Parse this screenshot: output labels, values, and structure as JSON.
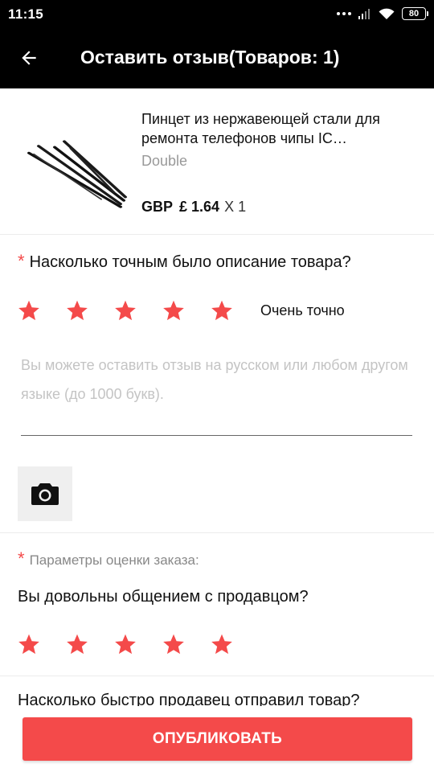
{
  "status_bar": {
    "time": "11:15",
    "battery": "80"
  },
  "app_bar": {
    "title": "Оставить отзыв(Товаров: 1)"
  },
  "product": {
    "title": "Пинцет из нержавеющей стали для ремонта телефонов чипы IC…",
    "store": "Double",
    "currency": "GBP",
    "price": "£ 1.64",
    "quantity": "X 1"
  },
  "description_section": {
    "required_mark": "*",
    "question": "Насколько точным было описание товара?",
    "rating": 5,
    "max_rating": 5,
    "rating_text": "Очень точно",
    "star_color": "#f44a4a"
  },
  "review": {
    "placeholder": "Вы можете оставить отзыв на русском или любом другом языке (до 1000 букв).",
    "value": ""
  },
  "photo_button": {
    "icon": "camera-icon"
  },
  "order_params": {
    "required_mark": "*",
    "label": "Параметры оценки заказа:",
    "seller_communication": {
      "question": "Вы довольны общением с продавцом?",
      "rating": 5
    },
    "shipping_speed": {
      "question": "Насколько быстро продавец отправил товар?"
    }
  },
  "publish_button": {
    "label": "ОПУБЛИКОВАТЬ",
    "color": "#f44a4a"
  }
}
